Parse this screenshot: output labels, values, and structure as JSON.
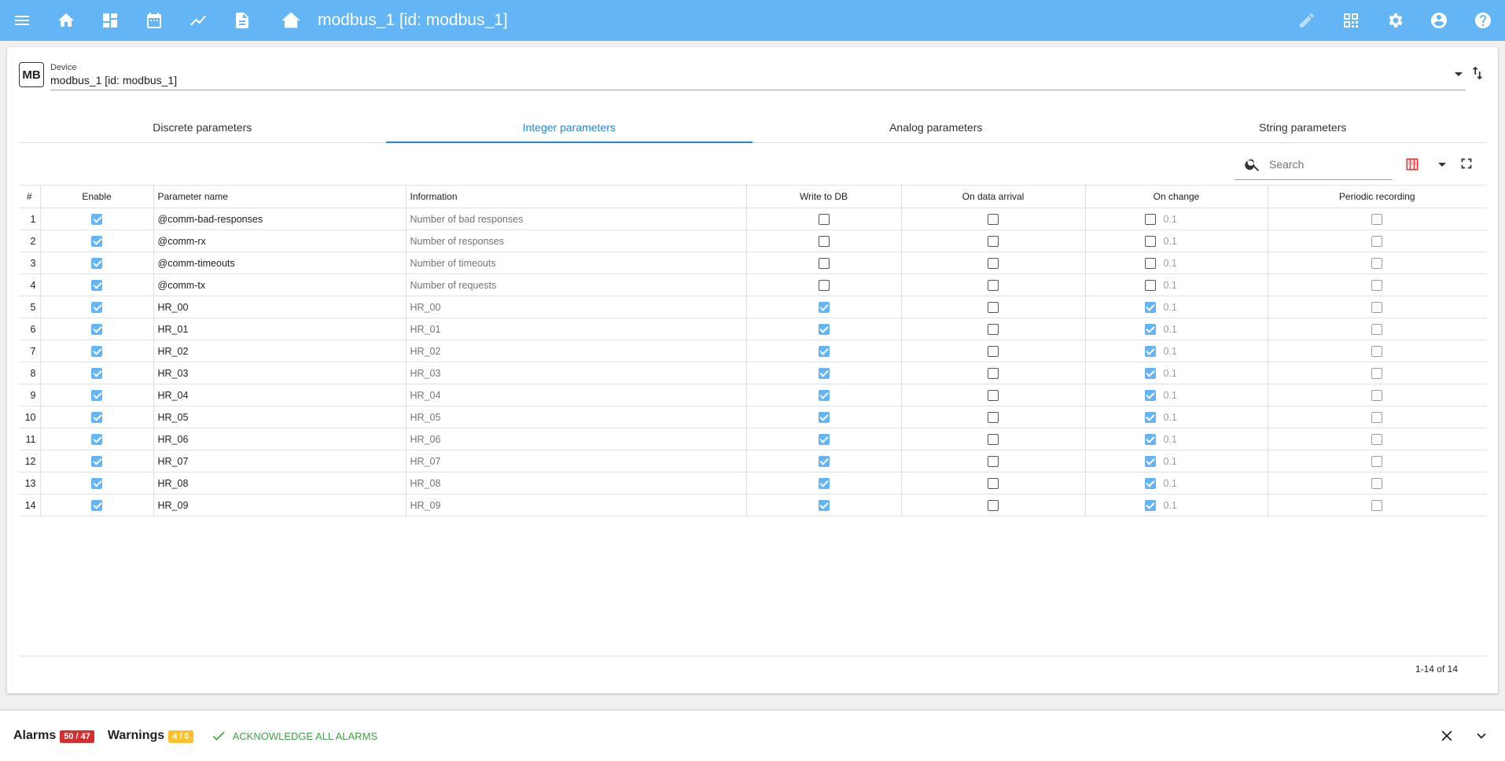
{
  "appbar": {
    "title": "modbus_1 [id: modbus_1]",
    "icons": [
      "menu-icon",
      "home-icon",
      "dashboards-icon",
      "calendar-icon",
      "chart-icon",
      "document-icon",
      "device-home-icon",
      "edit-icon",
      "widgets-icon",
      "settings-icon",
      "account-icon",
      "help-icon"
    ]
  },
  "device": {
    "badge": "MB",
    "label": "Device",
    "value": "modbus_1 [id: modbus_1]"
  },
  "tabs": [
    {
      "label": "Discrete parameters"
    },
    {
      "label": "Integer parameters"
    },
    {
      "label": "Analog parameters"
    },
    {
      "label": "String parameters"
    }
  ],
  "active_tab": "Integer parameters",
  "search": {
    "placeholder": "Search"
  },
  "table": {
    "headers": {
      "num": "#",
      "enable": "Enable",
      "name": "Parameter name",
      "info": "Information",
      "write_db": "Write to DB",
      "on_arrival": "On data arrival",
      "on_change": "On change",
      "periodic": "Periodic recording"
    },
    "rows": [
      {
        "num": "1",
        "name": "@comm-bad-responses",
        "info": "Number of bad responses",
        "enable": true,
        "write_db": false,
        "on_arrival": false,
        "on_change": false,
        "change_value": "0.1",
        "periodic": false
      },
      {
        "num": "2",
        "name": "@comm-rx",
        "info": "Number of responses",
        "enable": true,
        "write_db": false,
        "on_arrival": false,
        "on_change": false,
        "change_value": "0.1",
        "periodic": false
      },
      {
        "num": "3",
        "name": "@comm-timeouts",
        "info": "Number of timeouts",
        "enable": true,
        "write_db": false,
        "on_arrival": false,
        "on_change": false,
        "change_value": "0.1",
        "periodic": false
      },
      {
        "num": "4",
        "name": "@comm-tx",
        "info": "Number of requests",
        "enable": true,
        "write_db": false,
        "on_arrival": false,
        "on_change": false,
        "change_value": "0.1",
        "periodic": false
      },
      {
        "num": "5",
        "name": "HR_00",
        "info": "HR_00",
        "enable": true,
        "write_db": true,
        "on_arrival": false,
        "on_change": true,
        "change_value": "0.1",
        "periodic": false
      },
      {
        "num": "6",
        "name": "HR_01",
        "info": "HR_01",
        "enable": true,
        "write_db": true,
        "on_arrival": false,
        "on_change": true,
        "change_value": "0.1",
        "periodic": false
      },
      {
        "num": "7",
        "name": "HR_02",
        "info": "HR_02",
        "enable": true,
        "write_db": true,
        "on_arrival": false,
        "on_change": true,
        "change_value": "0.1",
        "periodic": false
      },
      {
        "num": "8",
        "name": "HR_03",
        "info": "HR_03",
        "enable": true,
        "write_db": true,
        "on_arrival": false,
        "on_change": true,
        "change_value": "0.1",
        "periodic": false
      },
      {
        "num": "9",
        "name": "HR_04",
        "info": "HR_04",
        "enable": true,
        "write_db": true,
        "on_arrival": false,
        "on_change": true,
        "change_value": "0.1",
        "periodic": false
      },
      {
        "num": "10",
        "name": "HR_05",
        "info": "HR_05",
        "enable": true,
        "write_db": true,
        "on_arrival": false,
        "on_change": true,
        "change_value": "0.1",
        "periodic": false
      },
      {
        "num": "11",
        "name": "HR_06",
        "info": "HR_06",
        "enable": true,
        "write_db": true,
        "on_arrival": false,
        "on_change": true,
        "change_value": "0.1",
        "periodic": false
      },
      {
        "num": "12",
        "name": "HR_07",
        "info": "HR_07",
        "enable": true,
        "write_db": true,
        "on_arrival": false,
        "on_change": true,
        "change_value": "0.1",
        "periodic": false
      },
      {
        "num": "13",
        "name": "HR_08",
        "info": "HR_08",
        "enable": true,
        "write_db": true,
        "on_arrival": false,
        "on_change": true,
        "change_value": "0.1",
        "periodic": false
      },
      {
        "num": "14",
        "name": "HR_09",
        "info": "HR_09",
        "enable": true,
        "write_db": true,
        "on_arrival": false,
        "on_change": true,
        "change_value": "0.1",
        "periodic": false
      }
    ],
    "pagination": "1-14 of 14"
  },
  "alarms": {
    "alarms_label": "Alarms",
    "alarms_count": "50 / 47",
    "warnings_label": "Warnings",
    "warnings_count": "4 / 0",
    "ack_label": "ACKNOWLEDGE ALL ALARMS"
  },
  "colors": {
    "appbar": "#64b5f6",
    "accent": "#1e88e5",
    "checkbox_on": "#64b5f6",
    "alarm_badge": "#d32f2f",
    "warning_badge": "#fbc02d",
    "ack": "#43a047",
    "columns_icon": "#e53935"
  }
}
